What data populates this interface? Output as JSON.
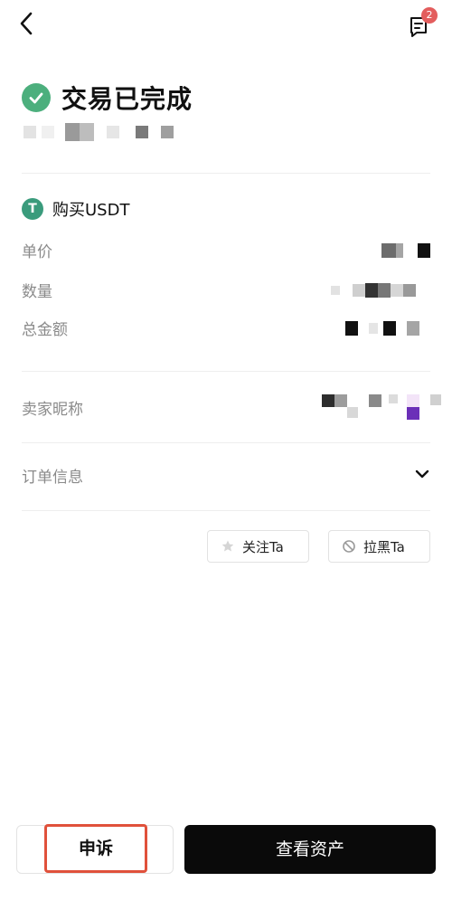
{
  "header": {
    "back_icon": "chevron-left-icon",
    "message_icon": "message-icon",
    "message_badge": "2"
  },
  "status": {
    "icon": "check-circle-icon",
    "title": "交易已完成"
  },
  "order": {
    "asset_icon": "tether-icon",
    "asset_icon_glyph": "T",
    "title": "购买USDT",
    "unit_price_label": "单价",
    "quantity_label": "数量",
    "total_label": "总金额",
    "seller_label": "卖家昵称",
    "order_info_label": "订单信息"
  },
  "actions": {
    "follow_label": "关注Ta",
    "block_label": "拉黑Ta",
    "appeal_label": "申诉",
    "view_assets_label": "查看资产"
  },
  "colors": {
    "success": "#4caf7d",
    "tether": "#3a9b7c",
    "badge": "#e35d5d",
    "highlight": "#e0513b",
    "primary_button": "#0a0a0a"
  }
}
